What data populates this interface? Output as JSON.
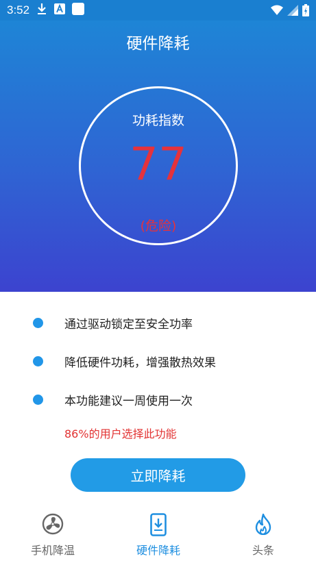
{
  "status_bar": {
    "time": "3:52"
  },
  "header": {
    "title": "硬件降耗"
  },
  "gauge": {
    "label": "功耗指数",
    "value": "77",
    "status": "(危险)"
  },
  "features": [
    "通过驱动锁定至安全功率",
    "降低硬件功耗，增强散热效果",
    "本功能建议一周使用一次"
  ],
  "note": "86%的用户选择此功能",
  "primary_button": "立即降耗",
  "bottom_nav": [
    {
      "label": "手机降温",
      "icon": "fan-icon",
      "active": false
    },
    {
      "label": "硬件降耗",
      "icon": "phone-download-icon",
      "active": true
    },
    {
      "label": "头条",
      "icon": "flame-icon",
      "active": false
    }
  ],
  "colors": {
    "accent": "#229be6",
    "danger": "#e5323c",
    "nav_active": "#1f8fe0",
    "nav_inactive": "#666666"
  }
}
